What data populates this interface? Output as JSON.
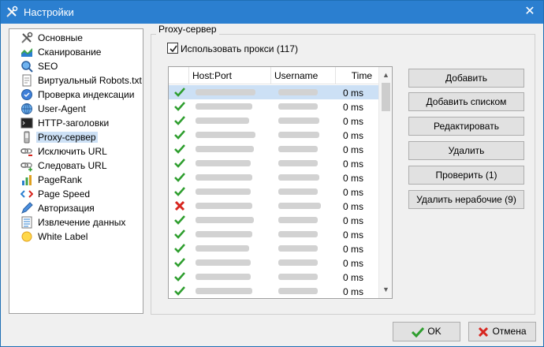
{
  "window": {
    "title": "Настройки",
    "close_glyph": "✕"
  },
  "tree": {
    "items": [
      {
        "label": "Основные",
        "icon": "tools-icon"
      },
      {
        "label": "Сканирование",
        "icon": "chart-area-icon"
      },
      {
        "label": "SEO",
        "icon": "magnifier-icon"
      },
      {
        "label": "Виртуальный Robots.txt",
        "icon": "document-icon"
      },
      {
        "label": "Проверка индексации",
        "icon": "blue-circle-icon"
      },
      {
        "label": "User-Agent",
        "icon": "globe-icon"
      },
      {
        "label": "HTTP-заголовки",
        "icon": "terminal-icon"
      },
      {
        "label": "Proxy-сервер",
        "icon": "phone-icon",
        "selected": true
      },
      {
        "label": "Исключить URL",
        "icon": "link-minus-icon"
      },
      {
        "label": "Следовать URL",
        "icon": "link-plus-icon"
      },
      {
        "label": "PageRank",
        "icon": "bars-icon"
      },
      {
        "label": "Page Speed",
        "icon": "code-icon"
      },
      {
        "label": "Авторизация",
        "icon": "pen-icon"
      },
      {
        "label": "Извлечение данных",
        "icon": "list-icon"
      },
      {
        "label": "White Label",
        "icon": "sun-icon"
      }
    ]
  },
  "proxy": {
    "group_title": "Proxy-сервер",
    "use_proxy_label": "Использовать прокси (117)",
    "use_proxy_checked": true,
    "columns": [
      "Host:Port",
      "Username",
      "Time"
    ],
    "rows": [
      {
        "ok": true,
        "time": "0 ms",
        "selected": true
      },
      {
        "ok": true,
        "time": "0 ms"
      },
      {
        "ok": true,
        "time": "0 ms"
      },
      {
        "ok": true,
        "time": "0 ms"
      },
      {
        "ok": true,
        "time": "0 ms"
      },
      {
        "ok": true,
        "time": "0 ms"
      },
      {
        "ok": true,
        "time": "0 ms"
      },
      {
        "ok": true,
        "time": "0 ms"
      },
      {
        "ok": false,
        "time": "0 ms"
      },
      {
        "ok": true,
        "time": "0 ms"
      },
      {
        "ok": true,
        "time": "0 ms"
      },
      {
        "ok": true,
        "time": "0 ms"
      },
      {
        "ok": true,
        "time": "0 ms"
      },
      {
        "ok": true,
        "time": "0 ms"
      },
      {
        "ok": true,
        "time": "0 ms"
      }
    ]
  },
  "buttons": {
    "add": "Добавить",
    "add_list": "Добавить списком",
    "edit": "Редактировать",
    "delete": "Удалить",
    "check": "Проверить (1)",
    "delete_bad": "Удалить нерабочие (9)",
    "ok": "OK",
    "cancel": "Отмена"
  },
  "colors": {
    "ok_green": "#2e9e2e",
    "fail_red": "#d7261f",
    "selection": "#cce0f5",
    "titlebar": "#2b7fd0"
  }
}
